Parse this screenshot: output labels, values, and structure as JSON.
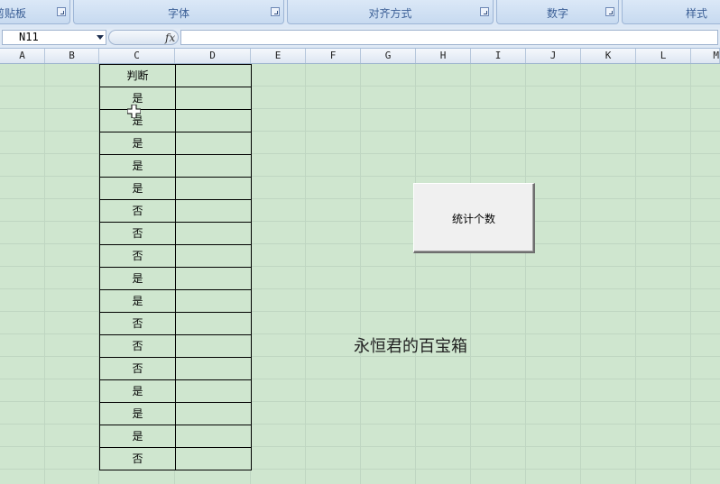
{
  "ribbon": {
    "groups": [
      {
        "label": "剪贴板"
      },
      {
        "label": "字体"
      },
      {
        "label": "对齐方式"
      },
      {
        "label": "数字"
      },
      {
        "label": "样式"
      }
    ]
  },
  "formula_bar": {
    "name_box": "N11",
    "formula_icon": "fx",
    "formula_value": ""
  },
  "columns": [
    "A",
    "B",
    "C",
    "D",
    "E",
    "F",
    "G",
    "H",
    "I",
    "J",
    "K",
    "L",
    "M"
  ],
  "table": {
    "header": "判断",
    "rows": [
      "是",
      "是",
      "是",
      "是",
      "是",
      "否",
      "否",
      "否",
      "是",
      "是",
      "否",
      "否",
      "否",
      "是",
      "是",
      "是",
      "否"
    ]
  },
  "button": {
    "label": "统计个数"
  },
  "watermark": "永恒君的百宝箱",
  "colors": {
    "sheet_background": "#cfe6cf",
    "ribbon_text": "#3b5f96"
  },
  "icons": [
    "dropdown-arrow-icon",
    "fx-icon",
    "dialog-launcher-icon",
    "move-cursor-icon"
  ]
}
